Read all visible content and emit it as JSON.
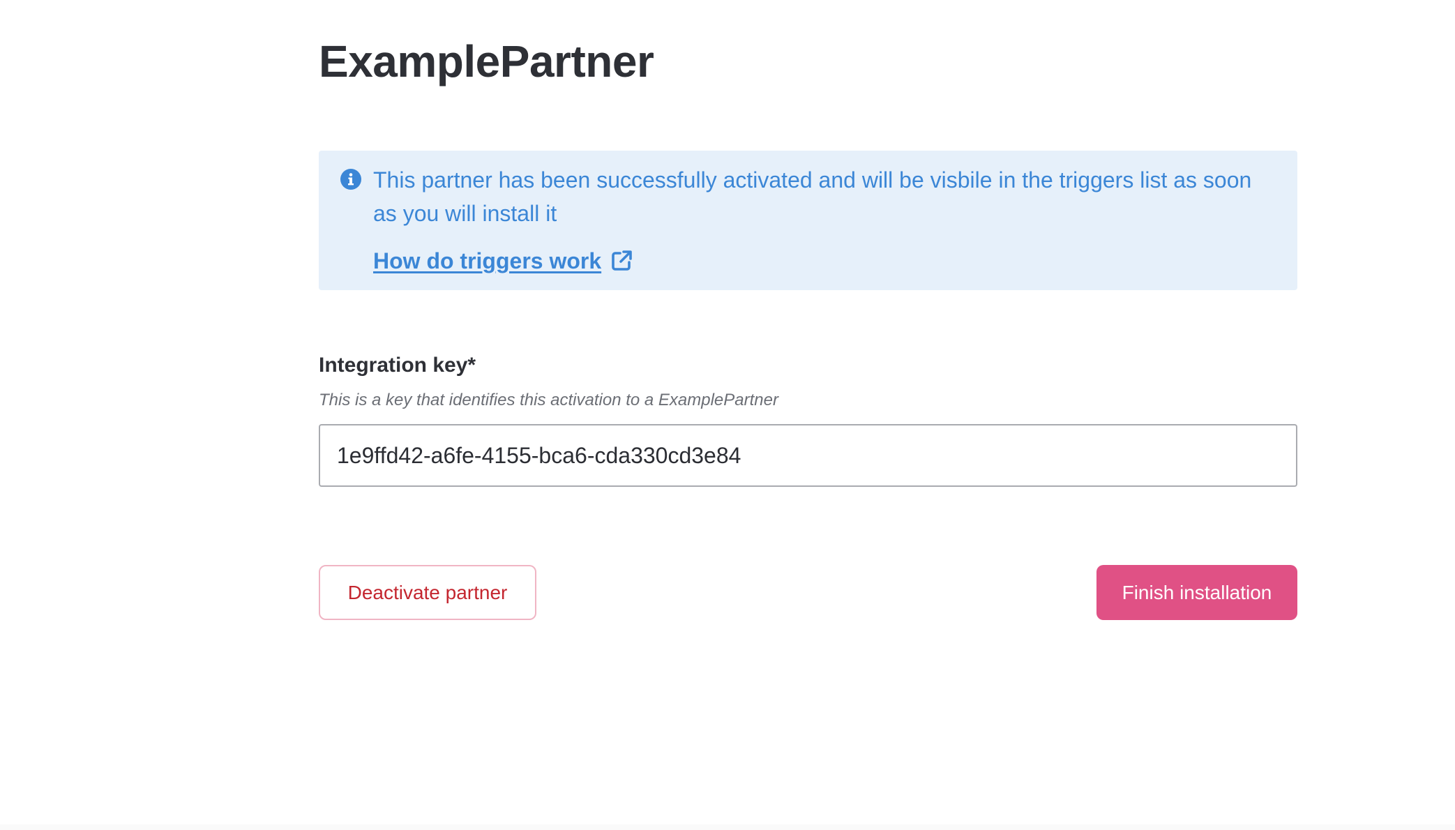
{
  "page": {
    "title": "ExamplePartner"
  },
  "info": {
    "message": "This partner has been successfully activated and will be visbile in the triggers list as soon as you will install it",
    "link_label": "How do triggers work",
    "icon": "info-circle-icon",
    "link_icon": "external-link-icon",
    "color": "#3b86d6",
    "background": "#e6f0fa"
  },
  "integration_key": {
    "label": "Integration key*",
    "hint": "This is a key that identifies this activation to a ExamplePartner",
    "value": "1e9ffd42-a6fe-4155-bca6-cda330cd3e84"
  },
  "actions": {
    "deactivate_label": "Deactivate partner",
    "finish_label": "Finish installation",
    "deactivate_color": "#c4262f",
    "finish_color": "#e05185"
  }
}
